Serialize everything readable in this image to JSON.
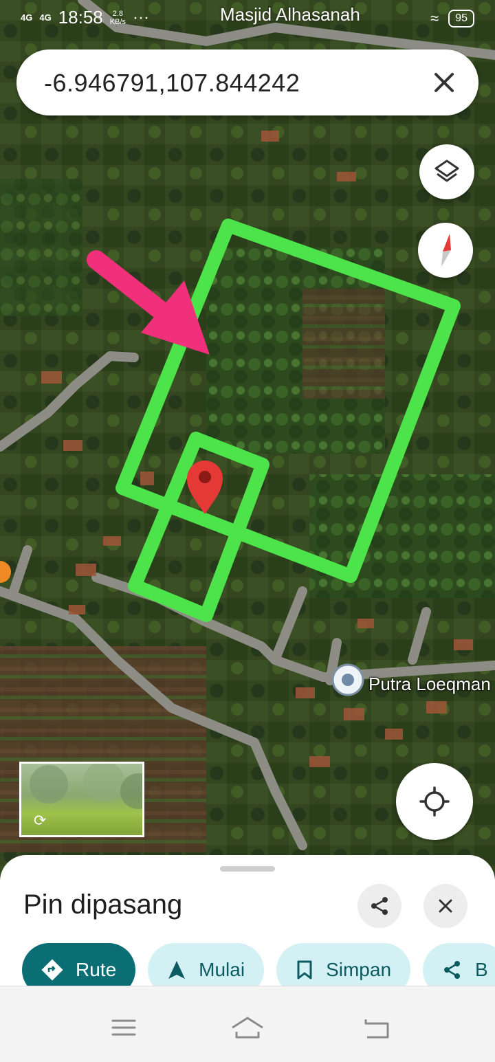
{
  "status_bar": {
    "network_1": "4G",
    "network_2": "4G",
    "time": "18:58",
    "speed_value": "2.8",
    "speed_unit": "KB/s",
    "more": "···",
    "place_label": "Masjid Alhasanah",
    "battery": "95"
  },
  "search": {
    "query": "-6.946791,107.844242"
  },
  "map": {
    "place_labels": [
      "Putra Loeqman"
    ],
    "boundary_color": "#4de34a",
    "arrow_color": "#f0307a",
    "pin_color": "#e53935"
  },
  "place_sheet": {
    "title": "Pin dipasang",
    "actions": [
      {
        "label": "Rute",
        "icon": "directions-icon"
      },
      {
        "label": "Mulai",
        "icon": "navigation-arrow-icon"
      },
      {
        "label": "Simpan",
        "icon": "bookmark-icon"
      },
      {
        "label": "B",
        "icon": "share-icon"
      }
    ]
  },
  "accent_color": "#0b6e74"
}
